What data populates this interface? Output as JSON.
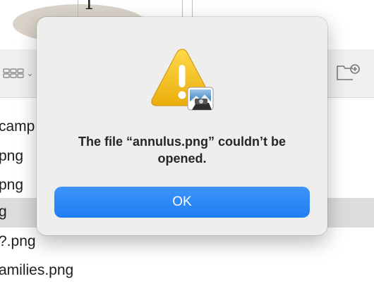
{
  "background": {
    "top_glyph": "1",
    "files": [
      "camp",
      "png",
      "png",
      "g",
      "?.png",
      "amilies.png"
    ],
    "selected_index": 3
  },
  "dialog": {
    "icon": "warning-triangle-with-app-badge-icon",
    "message": "The file “annulus.png” couldn’t be opened.",
    "ok_label": "OK"
  },
  "colors": {
    "accent": "#2b88f5",
    "warning": "#f3c11a",
    "dialog_bg": "#eeeeed",
    "selected_row": "#dcdcdc"
  }
}
